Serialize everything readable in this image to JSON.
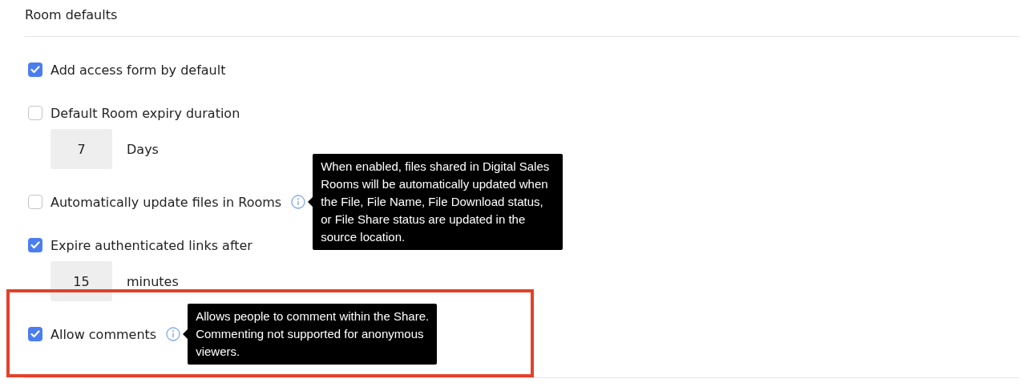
{
  "section": {
    "title": "Room defaults"
  },
  "settings": [
    {
      "label": "Add access form by default",
      "checked": true,
      "highlighted": false
    },
    {
      "label": "Default Room expiry duration",
      "checked": false,
      "highlighted": false,
      "field": {
        "value": "7",
        "unit": "Days"
      }
    },
    {
      "label": "Automatically update files in Rooms",
      "checked": false,
      "highlighted": false,
      "tooltip": "When enabled, files shared in Digital Sales Rooms will be automatically updated when the File, File Name, File Download status, or File Share status are updated in the source location."
    },
    {
      "label": "Expire authenticated links after",
      "checked": true,
      "highlighted": false,
      "field": {
        "value": "15",
        "unit": "minutes"
      }
    },
    {
      "label": "Allow comments",
      "checked": true,
      "highlighted": true,
      "tooltip": "Allows people to comment within the Share. Commenting not supported for anonymous viewers."
    }
  ]
}
